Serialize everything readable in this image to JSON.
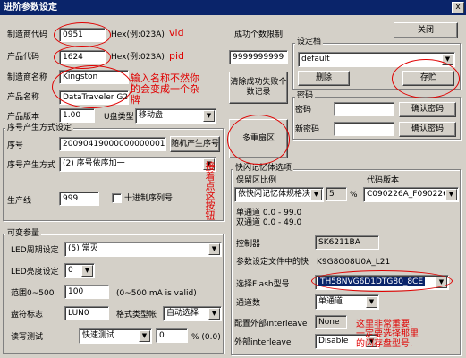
{
  "window": {
    "title": "进阶参数设定",
    "close_glyph": "x"
  },
  "left": {
    "vid_label": "制造商代码",
    "vid_value": "0951",
    "vid_hint": "Hex(例:023A)",
    "pid_label": "产品代码",
    "pid_value": "1624",
    "pid_hint": "Hex(例:023A)",
    "vendor_label": "制造商名称",
    "vendor_value": "Kingston",
    "product_label": "产品名称",
    "product_value": "DataTraveler G2",
    "version_label": "产品版本",
    "version_value": "1.00",
    "udisk_type_label": "U盘类型",
    "udisk_type_value": "移动盘"
  },
  "serial": {
    "group_title": "序号产生方式设定",
    "serial_label": "序号",
    "serial_value": "20090419000000000001",
    "random_button": "随机产生序号",
    "method_label": "序号产生方式",
    "method_value": "(2) 序号依序加一",
    "line_label": "生产线",
    "line_value": "999",
    "decimal_label": "十进制序列号"
  },
  "variable": {
    "group_title": "可变参量",
    "led_cycle_label": "LED周期设定",
    "led_cycle_value": "(5) 常灭",
    "led_bright_label": "LED亮度设定",
    "led_bright_value": "0",
    "range_label": "范围0~500",
    "range_value": "100",
    "range_hint": "(0~500 mA is valid)",
    "disk_label": "盘符标志",
    "disk_value": "LUN0",
    "format_label": "格式类型帐",
    "format_value": "自动选择",
    "rw_label": "读写测试",
    "rw_value": "快速测试",
    "rw_percent": "0",
    "rw_unit": "% (0.0)"
  },
  "middle": {
    "success_limit_label": "成功个数限制",
    "success_limit_value": "9999999999",
    "clear_button": "清除成功失败个数记录",
    "multi_partition_button": "多重扇区"
  },
  "settings": {
    "group_title": "设定档",
    "close_button": "关闭",
    "profile_value": "default",
    "delete_button": "删除",
    "save_button": "存贮"
  },
  "password": {
    "group_title": "密码",
    "password_label": "密码",
    "confirm_button": "确认密码",
    "new_password_label": "新密码",
    "confirm2_button": "确认密码"
  },
  "flash": {
    "group_title": "快闪记忆体选项",
    "reserve_label": "保留区比例",
    "reserve_value": "依快闪记忆体规格决定",
    "reserve_percent": "5",
    "percent_sign": "%",
    "code_version_label": "代码版本",
    "code_version_value": "C090226A_F090226A",
    "single_range": "单通道 0.0 - 99.0",
    "dual_range": "双通道 0.0 - 49.0",
    "controller_label": "控制器",
    "controller_value": "SK6211BA",
    "param_file_label": "参数设定文件中的快",
    "param_file_value": "K9G8G08U0A_L21",
    "flash_type_label": "选择Flash型号",
    "flash_type_value": "TH58NVG6D1DTG80_8CE",
    "channel_label": "通道数",
    "channel_value": "单通道",
    "ext_label": "配置外部interleave",
    "ext_value": "None",
    "ext2_label": "外部interleave",
    "ext2_value": "Disable"
  },
  "annotations": {
    "vid": "vid",
    "pid": "pid",
    "name_note_1": "输入名称不然你",
    "name_note_2": "的会变成一个杂",
    "name_note_3": "牌",
    "next_step_note": "接着点这按钮",
    "important_1": "这里非常重要.",
    "important_2": "一定要选择那里",
    "important_3": "的闪存盘型号."
  },
  "colors": {
    "accent": "#0a246a",
    "annotation": "#e00000"
  }
}
